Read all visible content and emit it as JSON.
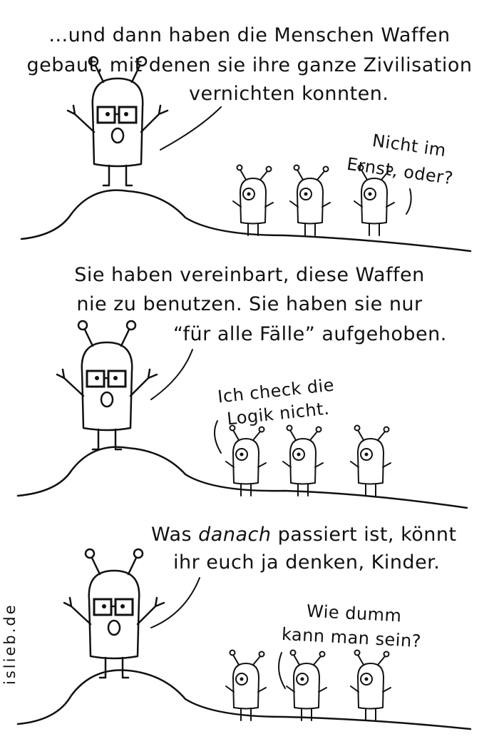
{
  "panels": [
    {
      "caption": [
        "...und dann haben die Menschen Waffen",
        "gebaut, mit denen sie ihre ganze Zivilisation",
        "vernichten konnten."
      ],
      "reply": [
        "Nicht im",
        "Ernst, oder?"
      ]
    },
    {
      "caption": [
        "Sie haben vereinbart, diese Waffen",
        "nie zu benutzen. Sie haben sie nur",
        "“für alle Fälle” aufgehoben."
      ],
      "reply": [
        "Ich check die",
        "Logik nicht."
      ]
    },
    {
      "caption_emph": {
        "before": "Was ",
        "emph": "danach",
        "after": " passiert ist, könnt"
      },
      "caption": [
        "ihr euch ja denken, Kinder."
      ],
      "reply": [
        "Wie dumm",
        "kann man sein?"
      ]
    }
  ],
  "signature": "islieb.de",
  "colors": {
    "ink": "#111111",
    "background": "#ffffff"
  }
}
